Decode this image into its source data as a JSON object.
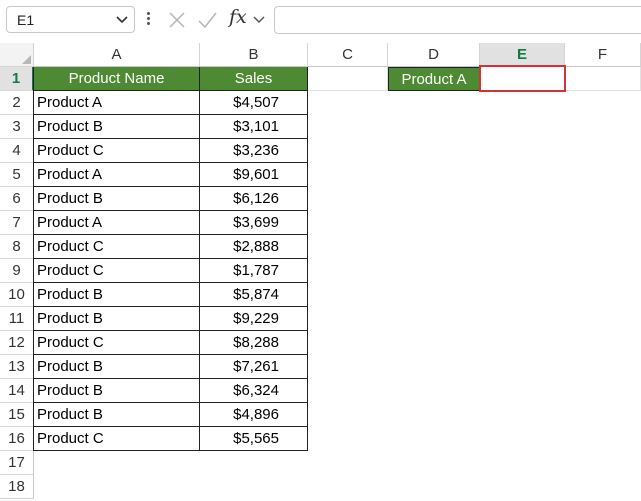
{
  "formula_bar": {
    "name_box": "E1",
    "fx_label": "fx",
    "formula": ""
  },
  "columns": [
    "A",
    "B",
    "C",
    "D",
    "E",
    "F"
  ],
  "rows": [
    "1",
    "2",
    "3",
    "4",
    "5",
    "6",
    "7",
    "8",
    "9",
    "10",
    "11",
    "12",
    "13",
    "14",
    "15",
    "16",
    "17",
    "18"
  ],
  "table": {
    "headers": [
      "Product Name",
      "Sales"
    ],
    "rows": [
      [
        "Product A",
        "$4,507"
      ],
      [
        "Product B",
        "$3,101"
      ],
      [
        "Product C",
        "$3,236"
      ],
      [
        "Product A",
        "$9,601"
      ],
      [
        "Product B",
        "$6,126"
      ],
      [
        "Product A",
        "$3,699"
      ],
      [
        "Product C",
        "$2,888"
      ],
      [
        "Product C",
        "$1,787"
      ],
      [
        "Product B",
        "$5,874"
      ],
      [
        "Product B",
        "$9,229"
      ],
      [
        "Product C",
        "$8,288"
      ],
      [
        "Product B",
        "$7,261"
      ],
      [
        "Product B",
        "$6,324"
      ],
      [
        "Product B",
        "$4,896"
      ],
      [
        "Product C",
        "$5,565"
      ]
    ]
  },
  "criteria_cell": {
    "D1": "Product A",
    "E1": ""
  },
  "colors": {
    "header_green": "#4e8a34",
    "selection_red": "#d13438",
    "excel_green": "#107c41"
  }
}
